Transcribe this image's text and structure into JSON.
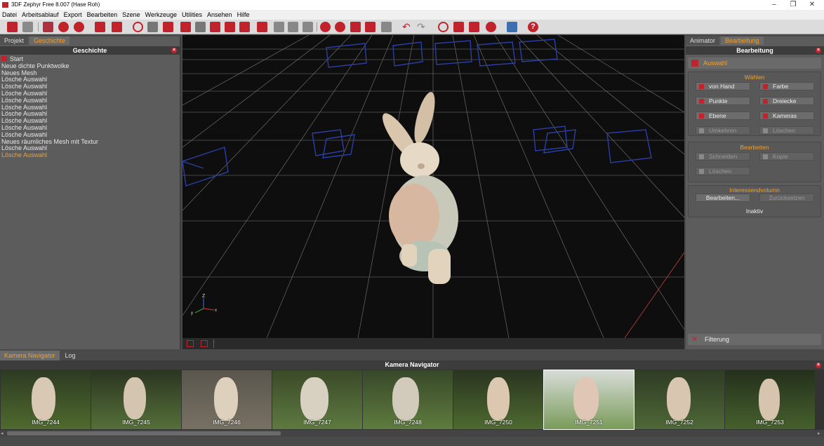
{
  "window": {
    "title": "3DF Zephyr Free 8.007 (Hase Roh)"
  },
  "menu": [
    "Datei",
    "Arbeitsablauf",
    "Export",
    "Bearbeiten",
    "Szene",
    "Werkzeuge",
    "Utilities",
    "Ansehen",
    "Hilfe"
  ],
  "left_panel": {
    "tabs": [
      "Projekt",
      "Geschichte"
    ],
    "title": "Geschichte",
    "history": [
      "Start",
      "Neue dichte Punktwolke",
      "Neues Mesh",
      "Lösche Auswahl",
      "Lösche Auswahl",
      "Lösche Auswahl",
      "Lösche Auswahl",
      "Lösche Auswahl",
      "Lösche Auswahl",
      "Lösche Auswahl",
      "Lösche Auswahl",
      "Lösche Auswahl",
      "Neues räumliches Mesh mit Textur",
      "Lösche Auswahl",
      "Lösche Auswahl"
    ]
  },
  "viewport": {
    "axis": {
      "z": "Z",
      "y": "y",
      "x": "x"
    }
  },
  "right_panel": {
    "tabs": [
      "Animator",
      "Bearbeitung"
    ],
    "title": "Bearbeitung",
    "section": "Auswahl",
    "waehlen": {
      "title": "Wählen",
      "buttons": [
        "von Hand",
        "Farbe",
        "Punkte",
        "Dreiecke",
        "Ebene",
        "Kameras",
        "Umkehren",
        "Löschen"
      ]
    },
    "bearbeiten": {
      "title": "Bearbeiten",
      "buttons": [
        "Schneiden",
        "Kopie",
        "Löschen"
      ]
    },
    "interessen": {
      "title": "Interessendvolumn",
      "buttons": [
        "Bearbeiten...",
        "Zurücksetzen"
      ],
      "status": "Inaktiv"
    },
    "filterung": "Filterung"
  },
  "bottom": {
    "tabs": [
      "Kamera Navigator",
      "Log"
    ],
    "title": "Kamera Navigator",
    "images": [
      "IMG_7244",
      "IMG_7245",
      "IMG_7246",
      "IMG_7247",
      "IMG_7248",
      "IMG_7250",
      "IMG_7251",
      "IMG_7252",
      "IMG_7253"
    ]
  },
  "colors": {
    "accent": "#f0a030",
    "brand": "#c0232c",
    "panel": "#5c5c5c"
  }
}
